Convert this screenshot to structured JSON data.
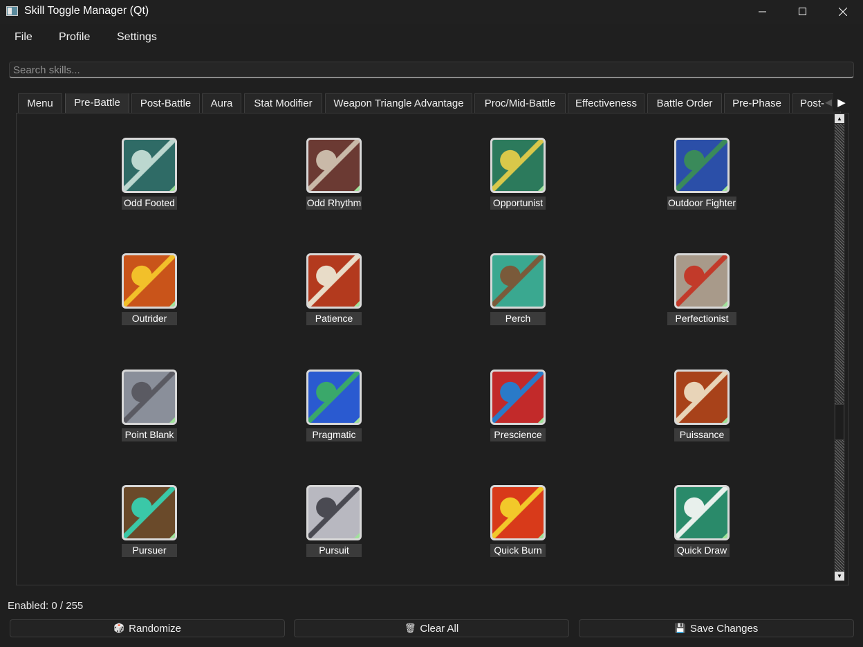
{
  "window": {
    "title": "Skill Toggle Manager (Qt)"
  },
  "menu": [
    "File",
    "Profile",
    "Settings"
  ],
  "search": {
    "placeholder": "Search skills...",
    "value": ""
  },
  "tabs": [
    {
      "label": "Menu"
    },
    {
      "label": "Pre-Battle",
      "active": true
    },
    {
      "label": "Post-Battle"
    },
    {
      "label": "Aura"
    },
    {
      "label": "Stat Modifier"
    },
    {
      "label": "Weapon Triangle Advantage"
    },
    {
      "label": "Proc/Mid-Battle"
    },
    {
      "label": "Effectiveness"
    },
    {
      "label": "Battle Order"
    },
    {
      "label": "Pre-Phase"
    },
    {
      "label": "Post-"
    }
  ],
  "skills": [
    {
      "name": "Odd Footed",
      "icon": "odd-footed-icon",
      "colors": [
        "#2f6b66",
        "#bcd7cf"
      ],
      "checked": true
    },
    {
      "name": "Odd Rhythm",
      "icon": "odd-rhythm-icon",
      "colors": [
        "#6b3a33",
        "#c9b9a8"
      ],
      "checked": true
    },
    {
      "name": "Opportunist",
      "icon": "opportunist-icon",
      "colors": [
        "#2c7a5c",
        "#d9c84a"
      ],
      "checked": true
    },
    {
      "name": "Outdoor Fighter",
      "icon": "outdoor-fighter-icon",
      "colors": [
        "#2b4fa8",
        "#3a8a5a"
      ],
      "checked": true
    },
    {
      "name": "Outrider",
      "icon": "outrider-icon",
      "colors": [
        "#c9541a",
        "#f2c02a"
      ],
      "checked": true
    },
    {
      "name": "Patience",
      "icon": "patience-icon",
      "colors": [
        "#b33a1e",
        "#e8dcc8"
      ],
      "checked": true
    },
    {
      "name": "Perch",
      "icon": "perch-icon",
      "colors": [
        "#3aa890",
        "#7a5a3a"
      ],
      "checked": false
    },
    {
      "name": "Perfectionist",
      "icon": "perfectionist-icon",
      "colors": [
        "#a89a8a",
        "#c23a2a"
      ],
      "checked": true
    },
    {
      "name": "Point Blank",
      "icon": "point-blank-icon",
      "colors": [
        "#8a8f9a",
        "#5a5a62"
      ],
      "checked": true
    },
    {
      "name": "Pragmatic",
      "icon": "pragmatic-icon",
      "colors": [
        "#2a5ad0",
        "#3aa86a"
      ],
      "checked": true
    },
    {
      "name": "Prescience",
      "icon": "prescience-icon",
      "colors": [
        "#c22a2a",
        "#2a7ac8"
      ],
      "checked": true
    },
    {
      "name": "Puissance",
      "icon": "puissance-icon",
      "colors": [
        "#a8421a",
        "#e8d4b8"
      ],
      "checked": true
    },
    {
      "name": "Pursuer",
      "icon": "pursuer-icon",
      "colors": [
        "#6a4a2a",
        "#3ac8a8"
      ],
      "checked": true
    },
    {
      "name": "Pursuit",
      "icon": "pursuit-icon",
      "colors": [
        "#b8b8c0",
        "#4a4a52"
      ],
      "checked": true
    },
    {
      "name": "Quick Burn",
      "icon": "quick-burn-icon",
      "colors": [
        "#d83a1a",
        "#f2c82a"
      ],
      "checked": true
    },
    {
      "name": "Quick Draw",
      "icon": "quick-draw-icon",
      "colors": [
        "#2a8a6a",
        "#e8f0ec"
      ],
      "checked": true
    }
  ],
  "status": {
    "enabled_text": "Enabled: 0 / 255"
  },
  "buttons": {
    "randomize": {
      "label": "Randomize",
      "icon": "dice-icon"
    },
    "clear_all": {
      "label": "Clear All",
      "icon": "trash-icon"
    },
    "save": {
      "label": "Save Changes",
      "icon": "floppy-disk-icon"
    }
  }
}
